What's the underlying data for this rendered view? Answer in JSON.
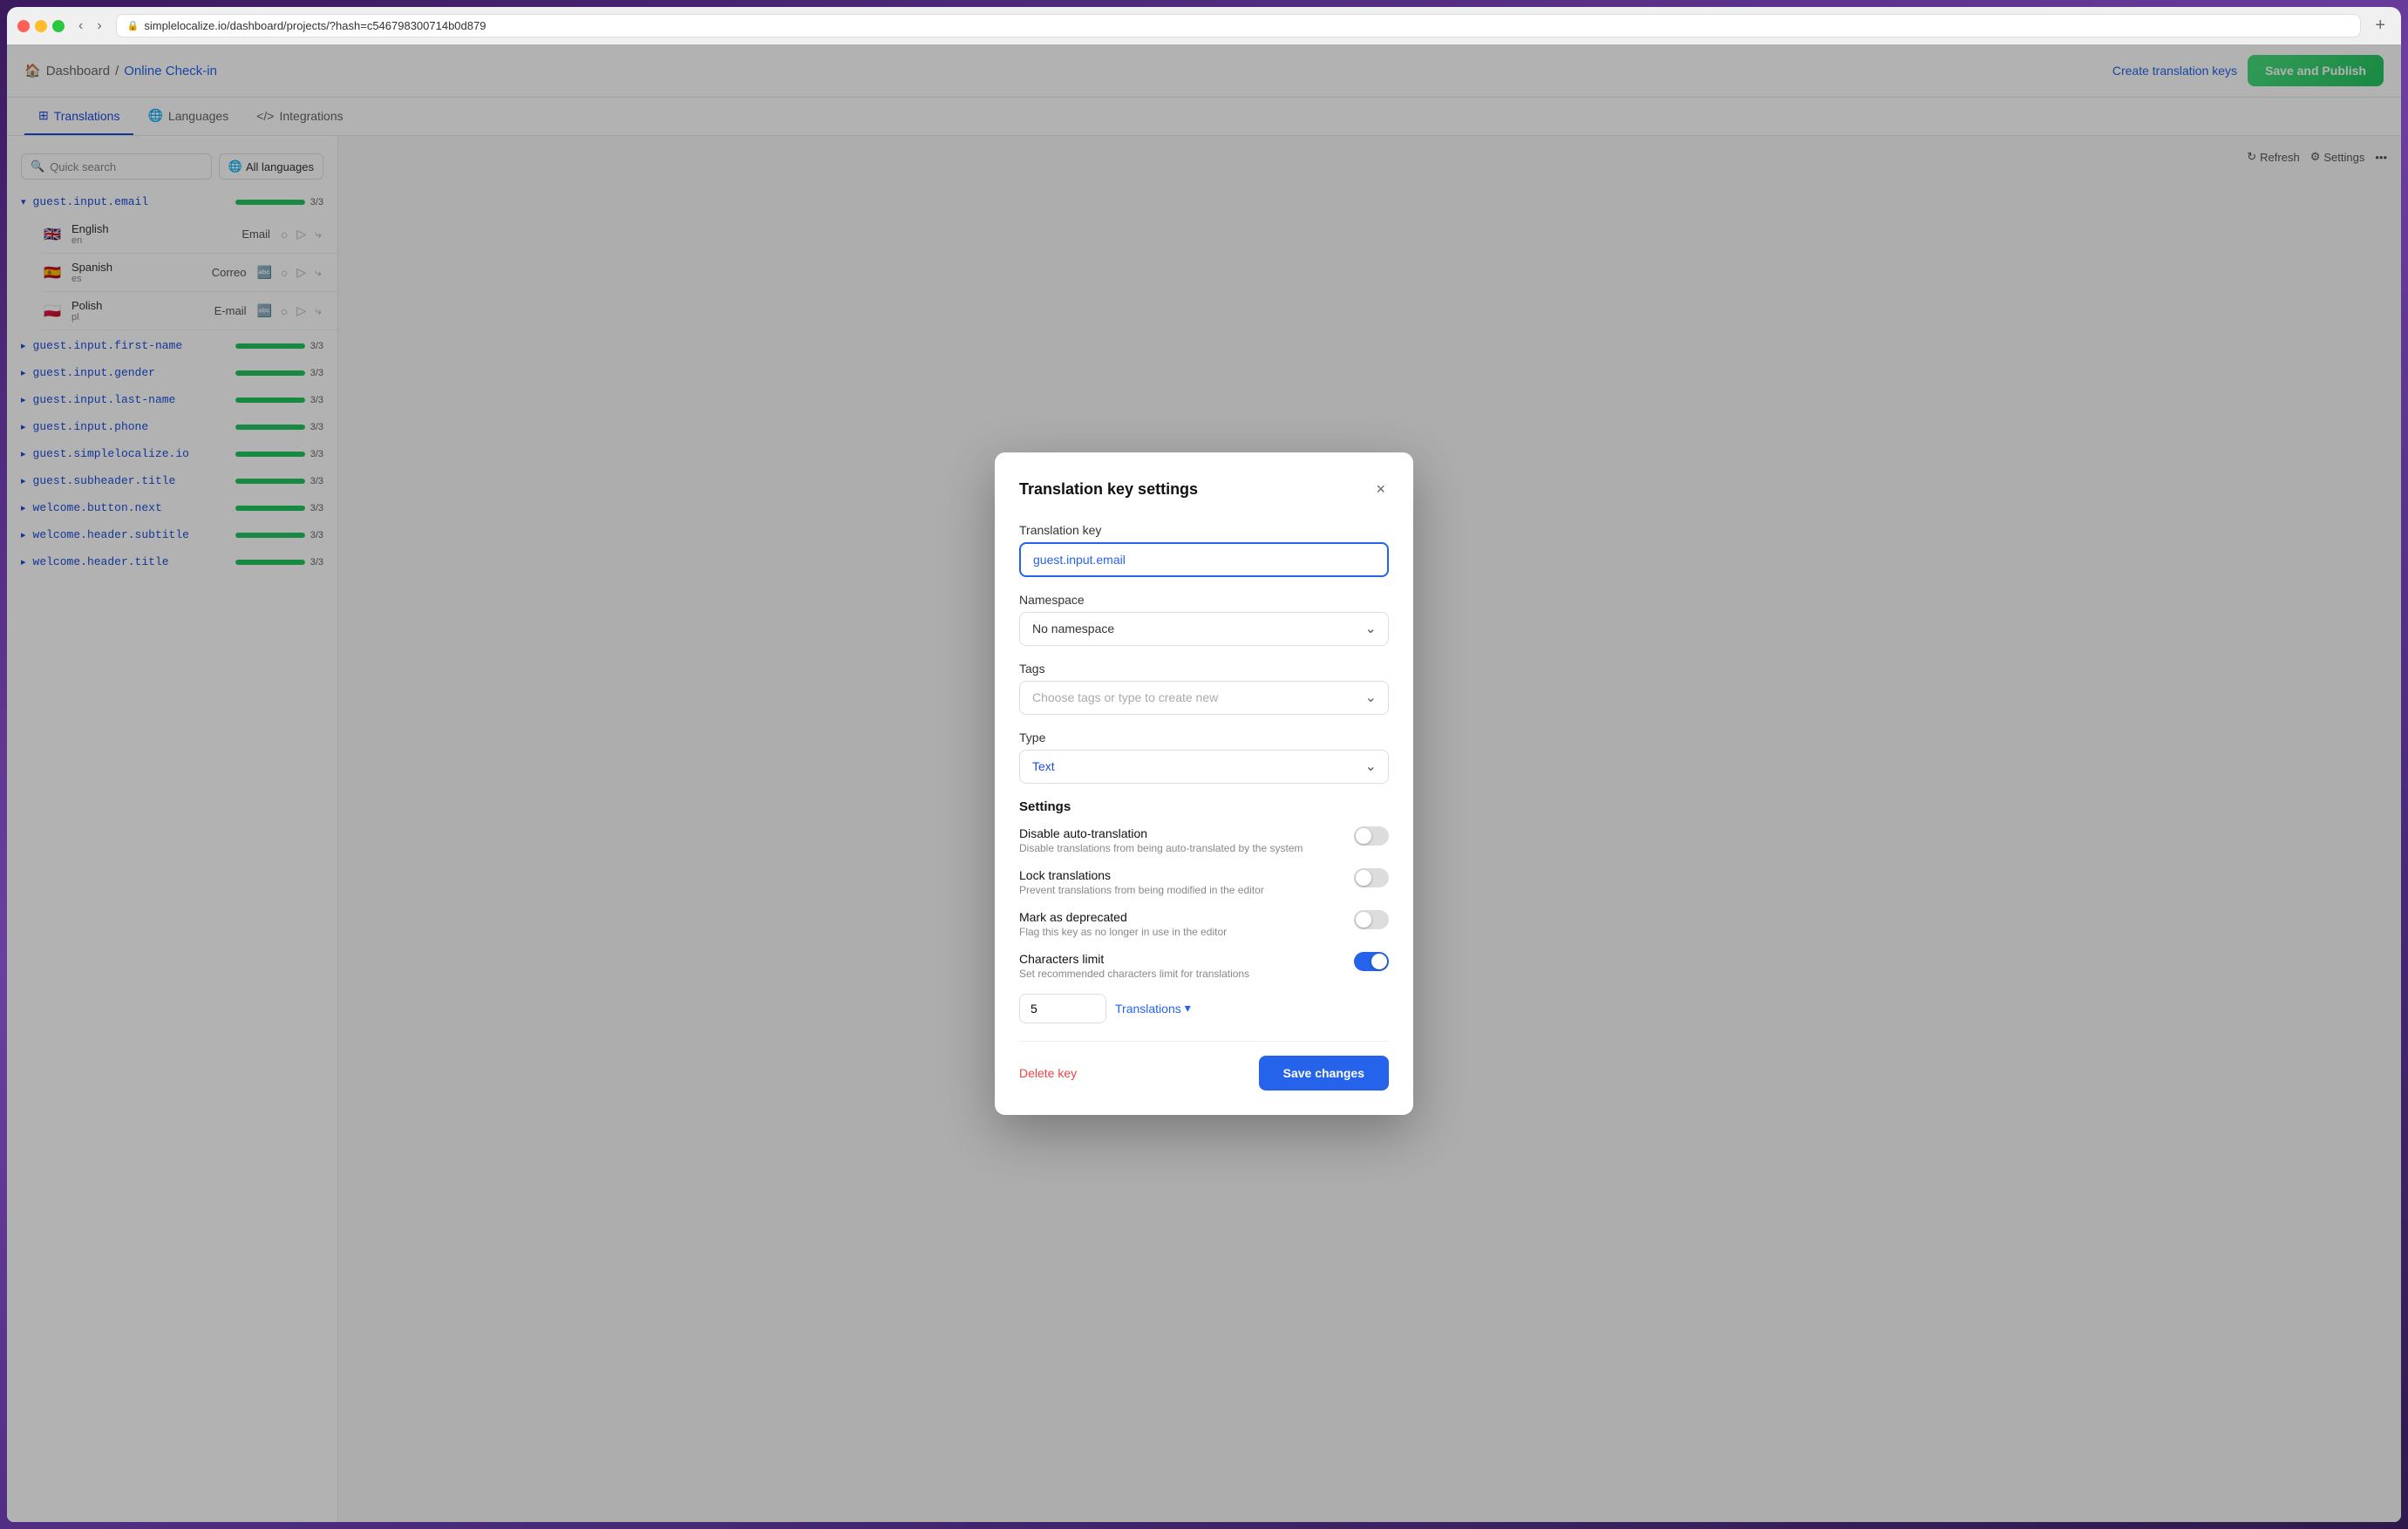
{
  "browser": {
    "url": "simplelocalize.io/dashboard/projects/?hash=c546798300714b0d879",
    "tab_new": "+"
  },
  "topbar": {
    "breadcrumb_home": "Dashboard",
    "breadcrumb_sep": "/",
    "breadcrumb_current": "Online Check-in",
    "create_keys_label": "Create translation keys",
    "save_publish_label": "Save and Publish"
  },
  "tabs": [
    {
      "label": "Translations",
      "icon": "table-icon",
      "active": true
    },
    {
      "label": "Languages",
      "icon": "globe-icon",
      "active": false
    },
    {
      "label": "Integrations",
      "icon": "code-icon",
      "active": false
    }
  ],
  "sidebar": {
    "search_placeholder": "Quick search",
    "lang_selector_label": "All languages",
    "keys": [
      {
        "name": "guest.input.email",
        "expanded": true,
        "progress": "3/3",
        "langs": [
          {
            "flag": "🇬🇧",
            "name": "English",
            "code": "en",
            "value": "Email"
          },
          {
            "flag": "🇪🇸",
            "name": "Spanish",
            "code": "es",
            "value": "Correo"
          },
          {
            "flag": "🇵🇱",
            "name": "Polish",
            "code": "pl",
            "value": "E-mail"
          }
        ]
      },
      {
        "name": "guest.input.first-name",
        "expanded": false,
        "progress": "3/3"
      },
      {
        "name": "guest.input.gender",
        "expanded": false,
        "progress": "3/3"
      },
      {
        "name": "guest.input.last-name",
        "expanded": false,
        "progress": "3/3"
      },
      {
        "name": "guest.input.phone",
        "expanded": false,
        "progress": "3/3"
      },
      {
        "name": "guest.simplelocalize.io",
        "expanded": false,
        "progress": "3/3"
      },
      {
        "name": "guest.subheader.title",
        "expanded": false,
        "progress": "3/3"
      },
      {
        "name": "welcome.button.next",
        "expanded": false,
        "progress": "3/3"
      },
      {
        "name": "welcome.header.subtitle",
        "expanded": false,
        "progress": "3/3"
      },
      {
        "name": "welcome.header.title",
        "expanded": false,
        "progress": "3/3"
      }
    ]
  },
  "toolbar": {
    "refresh_label": "Refresh",
    "settings_label": "Settings"
  },
  "modal": {
    "title": "Translation key settings",
    "close_label": "×",
    "translation_key_label": "Translation key",
    "translation_key_value": "guest.input.email",
    "namespace_label": "Namespace",
    "namespace_value": "No namespace",
    "tags_label": "Tags",
    "tags_placeholder": "Choose tags or type to create new",
    "type_label": "Type",
    "type_value": "Text",
    "settings_section_label": "Settings",
    "disable_auto_translation_name": "Disable auto-translation",
    "disable_auto_translation_desc": "Disable translations from being auto-translated by the system",
    "lock_translations_name": "Lock translations",
    "lock_translations_desc": "Prevent translations from being modified in the editor",
    "mark_deprecated_name": "Mark as deprecated",
    "mark_deprecated_desc": "Flag this key as no longer in use in the editor",
    "chars_limit_name": "Characters limit",
    "chars_limit_desc": "Set recommended characters limit for translations",
    "chars_limit_value": "5",
    "translations_dropdown_label": "Translations",
    "delete_label": "Delete key",
    "save_label": "Save changes"
  }
}
